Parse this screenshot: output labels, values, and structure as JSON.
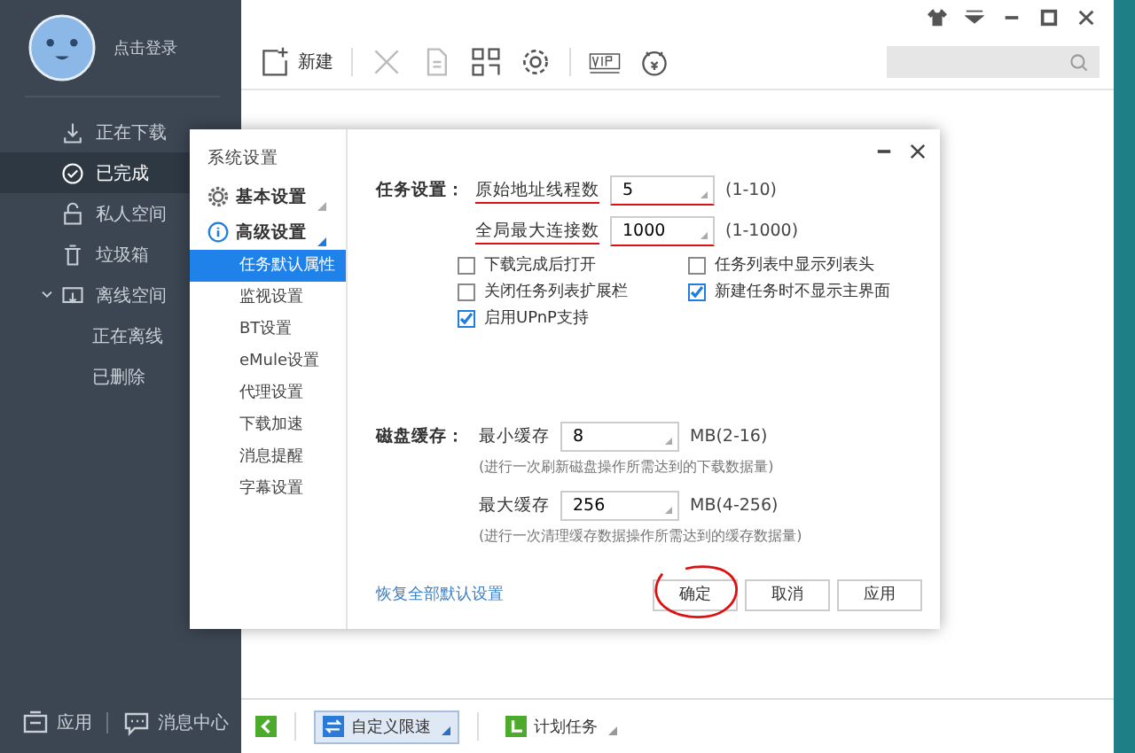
{
  "sidebar": {
    "user": "点击登录",
    "items": [
      {
        "label": "正在下载",
        "selected": false
      },
      {
        "label": "已完成",
        "selected": true
      },
      {
        "label": "私人空间",
        "selected": false
      },
      {
        "label": "垃圾箱",
        "selected": false
      },
      {
        "label": "离线空间",
        "selected": false,
        "children": [
          {
            "label": "正在离线",
            "selected": false
          },
          {
            "label": "已删除",
            "selected": false
          }
        ]
      }
    ],
    "footer": [
      "应用",
      "消息中心"
    ]
  },
  "toolbar": {
    "new_label": "新建"
  },
  "dialog": {
    "title": "系统设置",
    "groups": [
      {
        "label": "基本设置"
      },
      {
        "label": "高级设置",
        "items": [
          {
            "label": "任务默认属性",
            "selected": true
          },
          {
            "label": "监视设置",
            "selected": false
          },
          {
            "label": "BT设置",
            "selected": false
          },
          {
            "label": "eMule设置",
            "selected": false
          },
          {
            "label": "代理设置",
            "selected": false
          },
          {
            "label": "下载加速",
            "selected": false
          },
          {
            "label": "消息提醒",
            "selected": false
          },
          {
            "label": "字幕设置",
            "selected": false
          }
        ]
      }
    ],
    "task_section": "任务设置：",
    "task_fields": [
      {
        "label": "原始地址线程数",
        "value": "5",
        "range": "(1-10)"
      },
      {
        "label": "全局最大连接数",
        "value": "1000",
        "range": "(1-1000)"
      }
    ],
    "checkboxes": [
      {
        "label": "下载完成后打开",
        "checked": false
      },
      {
        "label": "任务列表中显示列表头",
        "checked": false
      },
      {
        "label": "关闭任务列表扩展栏",
        "checked": false
      },
      {
        "label": "新建任务时不显示主界面",
        "checked": true
      },
      {
        "label": "启用UPnP支持",
        "checked": true
      }
    ],
    "cache_section": "磁盘缓存：",
    "cache_fields": [
      {
        "label": "最小缓存",
        "value": "8",
        "range": "MB(2-16)",
        "note": "(进行一次刷新磁盘操作所需达到的下载数据量)"
      },
      {
        "label": "最大缓存",
        "value": "256",
        "range": "MB(4-256)",
        "note": "(进行一次清理缓存数据操作所需达到的缓存数据量)"
      }
    ],
    "restore_link": "恢复全部默认设置",
    "buttons": [
      "确定",
      "取消",
      "应用"
    ]
  },
  "bottom_bar": {
    "speed_label": "自定义限速",
    "speed_selected": true,
    "schedule_label": "计划任务"
  }
}
